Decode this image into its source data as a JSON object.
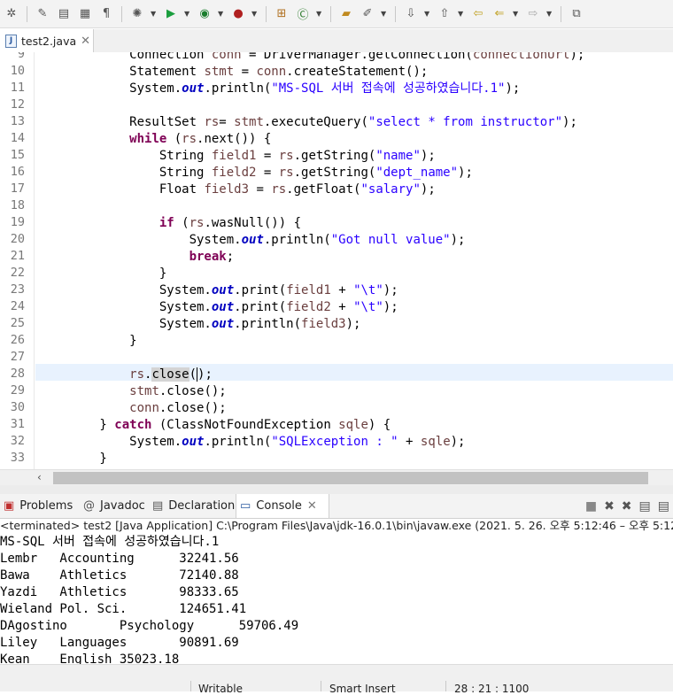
{
  "toolbar": {
    "icons": [
      "debug-perspective-icon",
      "run-icon",
      "coverage-icon",
      "external-tools-icon",
      "new-java-class-icon",
      "open-type-icon",
      "search-icon",
      "next-annotation-icon",
      "prev-annotation-icon",
      "back-icon",
      "forward-icon",
      "maximize-icon"
    ]
  },
  "editor": {
    "tab_label": "test2.java",
    "lines": [
      {
        "n": "9",
        "code": "            Connection conn = DriverManager.getConnection(connectionUrl);"
      },
      {
        "n": "10",
        "code": "            Statement stmt = conn.createStatement();"
      },
      {
        "n": "11",
        "code": "            System.out.println(\"MS-SQL 서버 접속에 성공하였습니다.1\");"
      },
      {
        "n": "12",
        "code": ""
      },
      {
        "n": "13",
        "code": "            ResultSet rs= stmt.executeQuery(\"select * from instructor\");"
      },
      {
        "n": "14",
        "code": "            while (rs.next()) {"
      },
      {
        "n": "15",
        "code": "                String field1 = rs.getString(\"name\");"
      },
      {
        "n": "16",
        "code": "                String field2 = rs.getString(\"dept_name\");"
      },
      {
        "n": "17",
        "code": "                Float field3 = rs.getFloat(\"salary\");"
      },
      {
        "n": "18",
        "code": ""
      },
      {
        "n": "19",
        "code": "                if (rs.wasNull()) {"
      },
      {
        "n": "20",
        "code": "                    System.out.println(\"Got null value\");"
      },
      {
        "n": "21",
        "code": "                    break;"
      },
      {
        "n": "22",
        "code": "                }"
      },
      {
        "n": "23",
        "code": "                System.out.print(field1 + \"\\t\");"
      },
      {
        "n": "24",
        "code": "                System.out.print(field2 + \"\\t\");"
      },
      {
        "n": "25",
        "code": "                System.out.println(field3);"
      },
      {
        "n": "26",
        "code": "            }"
      },
      {
        "n": "27",
        "code": ""
      },
      {
        "n": "28",
        "code": "            rs.close();"
      },
      {
        "n": "29",
        "code": "            stmt.close();"
      },
      {
        "n": "30",
        "code": "            conn.close();"
      },
      {
        "n": "31",
        "code": "        } catch (ClassNotFoundException sqle) {"
      },
      {
        "n": "32",
        "code": "            System.out.println(\"SQLException : \" + sqle);"
      },
      {
        "n": "33",
        "code": "        }"
      }
    ]
  },
  "views": {
    "tabs": [
      {
        "label": "Problems",
        "icon": "problems-icon"
      },
      {
        "label": "Javadoc",
        "icon": "javadoc-icon"
      },
      {
        "label": "Declaration",
        "icon": "declaration-icon"
      },
      {
        "label": "Console",
        "icon": "console-icon",
        "active": true
      }
    ]
  },
  "console": {
    "header": "<terminated> test2 [Java Application] C:\\Program Files\\Java\\jdk-16.0.1\\bin\\javaw.exe  (2021. 5. 26. 오후 5:12:46 – 오후 5:12",
    "lines": [
      "MS-SQL 서버 접속에 성공하였습니다.1",
      "Lembr   Accounting      32241.56",
      "Bawa    Athletics       72140.88",
      "Yazdi   Athletics       98333.65",
      "Wieland Pol. Sci.       124651.41",
      "DAgostino       Psychology      59706.49",
      "Liley   Languages       90891.69",
      "Kean    English 35023.18"
    ]
  },
  "statusbar": {
    "writable": "Writable",
    "insert_mode": "Smart Insert",
    "position": "28 : 21 : 1100"
  }
}
